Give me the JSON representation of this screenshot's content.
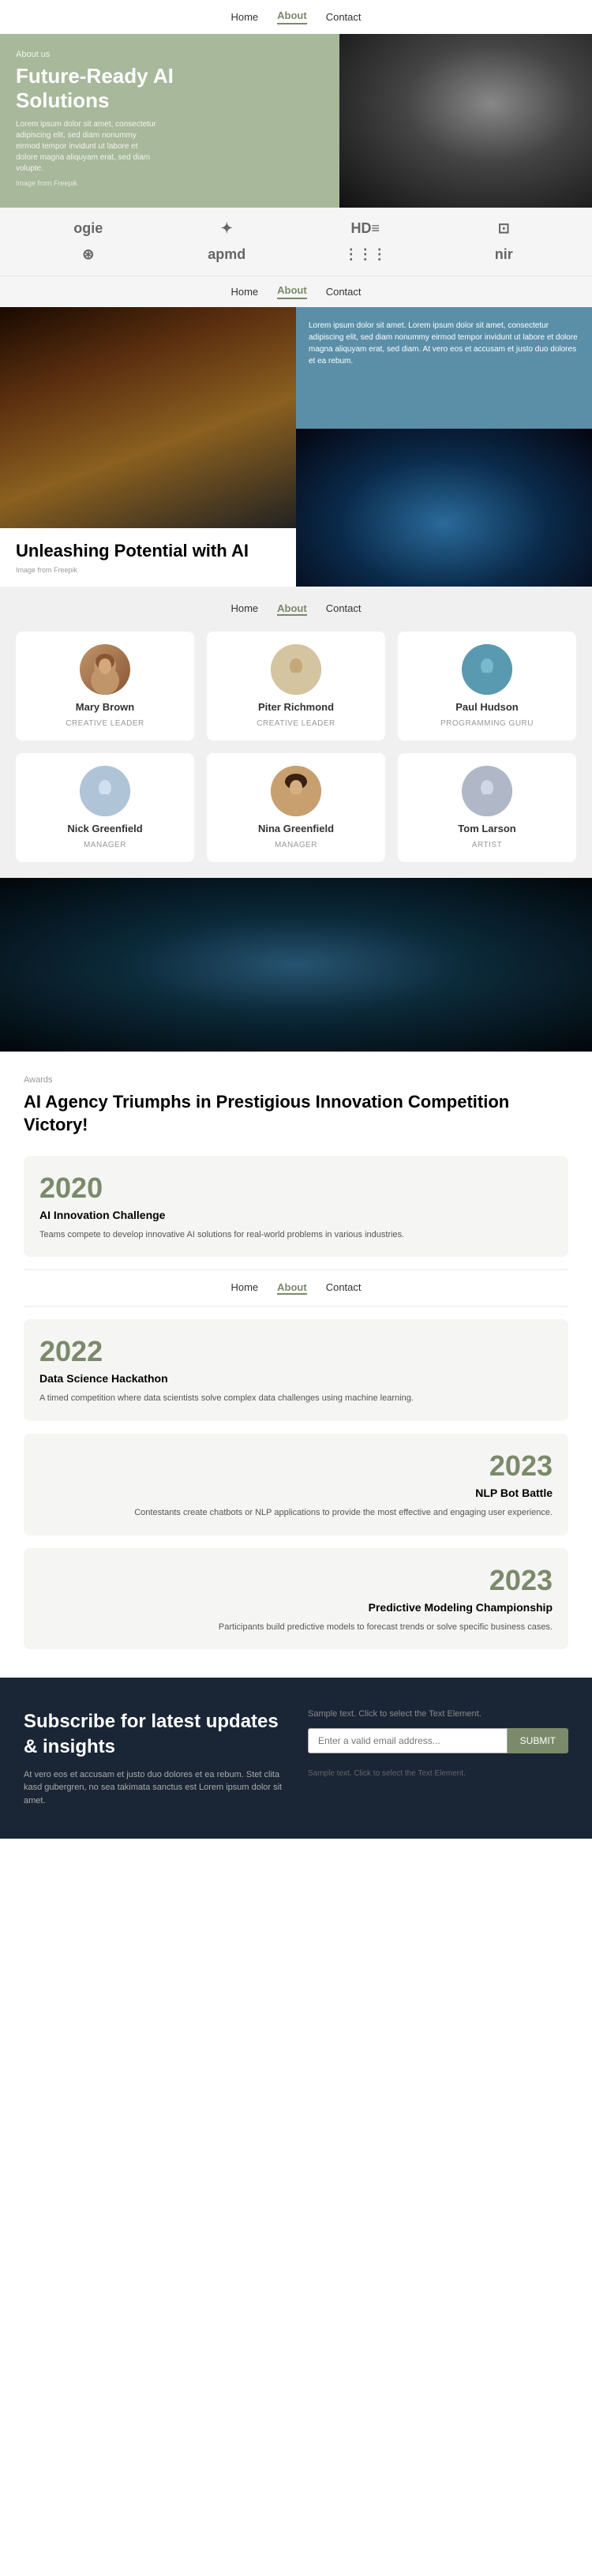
{
  "nav": {
    "home": "Home",
    "about": "About",
    "contact": "Contact"
  },
  "hero": {
    "about_us": "About us",
    "title": "Future-Ready AI Solutions",
    "description": "Lorem ipsum dolor sit amet, consectetur adipiscing elit, sed diam nonummy eirmod tempor invidunt ut labore et dolore magna aliquyam erat, sed diam volupte.",
    "img_from": "Image from Freepik"
  },
  "logos": [
    {
      "text": "ogie",
      "type": "text"
    },
    {
      "text": "✦",
      "type": "icon"
    },
    {
      "text": "HD≡",
      "type": "text"
    },
    {
      "text": "⊡",
      "type": "icon"
    },
    {
      "text": "⊛",
      "type": "icon"
    },
    {
      "text": "apmd",
      "type": "text"
    },
    {
      "text": "⋮⋮⋮",
      "type": "icon"
    },
    {
      "text": "nir",
      "type": "text"
    }
  ],
  "nav2": {
    "home": "Home",
    "about": "About",
    "contact": "Contact"
  },
  "unleashing": {
    "title": "Unleashing Potential with AI",
    "img_from": "Image from Freepik",
    "text_box": "Lorem ipsum dolor sit amet. Lorem ipsum dolor sit amet, consectetur adipiscing elit, sed diam nonummy eirmod tempor invidunt ut labore et dolore magna aliquyam erat, sed diam. At vero eos et accusam et justo duo dolores et ea rebum."
  },
  "team": {
    "nav": {
      "home": "Home",
      "about": "About",
      "contact": "Contact"
    },
    "members": [
      {
        "name": "Mary Brown",
        "role": "CREATIVE LEADER",
        "avatar_class": "av-mary"
      },
      {
        "name": "Piter Richmond",
        "role": "CREATIVE LEADER",
        "avatar_class": "av-piter"
      },
      {
        "name": "Paul Hudson",
        "role": "PROGRAMMING GURU",
        "avatar_class": "av-paul"
      },
      {
        "name": "Nick Greenfield",
        "role": "MANAGER",
        "avatar_class": "av-nick"
      },
      {
        "name": "Nina Greenfield",
        "role": "MANAGER",
        "avatar_class": "av-nina"
      },
      {
        "name": "Tom Larson",
        "role": "ARTIST",
        "avatar_class": "av-tom"
      }
    ]
  },
  "awards": {
    "label": "Awards",
    "title": "AI Agency Triumphs in Prestigious Innovation Competition Victory!",
    "nav": {
      "home": "Home",
      "about": "About",
      "contact": "Contact"
    },
    "items": [
      {
        "year": "2020",
        "name": "AI Innovation Challenge",
        "description": "Teams compete to develop innovative AI solutions for real-world problems in various industries.",
        "align": "left"
      },
      {
        "year": "2022",
        "name": "Data Science Hackathon",
        "description": "A timed competition where data scientists solve complex data challenges using machine learning.",
        "align": "left"
      },
      {
        "year": "2023",
        "name": "NLP Bot Battle",
        "description": "Contestants create chatbots or NLP applications to provide the most effective and engaging user experience.",
        "align": "right"
      },
      {
        "year": "2023",
        "name": "Predictive Modeling Championship",
        "description": "Participants build predictive models to forecast trends or solve specific business cases.",
        "align": "right"
      }
    ]
  },
  "subscribe": {
    "title": "Subscribe for latest updates & insights",
    "description": "At vero eos et accusam et justo duo dolores et ea rebum. Stet clita kasd gubergren, no sea takimata sanctus est Lorem ipsum dolor sit amet.",
    "sample_text": "Sample text. Click to select the Text Element.",
    "email_placeholder": "Enter a valid email address...",
    "button_label": "SUBMIT",
    "footer_text": "Sample text. Click to select the Text Element."
  }
}
